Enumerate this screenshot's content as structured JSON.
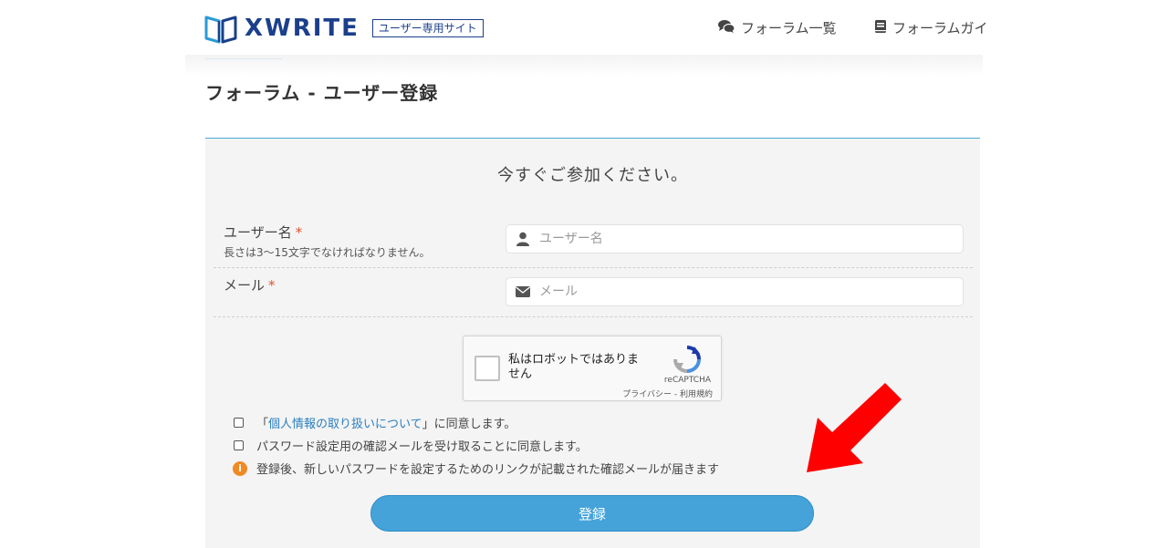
{
  "header": {
    "logo_text": "XWRITE",
    "logo_badge": "ユーザー専用サイト",
    "nav": [
      {
        "label": "フォーラム一覧",
        "icon": "comments-icon"
      },
      {
        "label": "フォーラムガイ",
        "icon": "book-icon"
      }
    ]
  },
  "page": {
    "title": "フォーラム - ユーザー登録"
  },
  "form": {
    "heading": "今すぐご参加ください。",
    "username": {
      "label": "ユーザー名",
      "required_mark": "*",
      "hint": "長さは3〜15文字でなければなりません。",
      "placeholder": "ユーザー名",
      "value": ""
    },
    "email": {
      "label": "メール",
      "required_mark": "*",
      "placeholder": "メール",
      "value": ""
    },
    "recaptcha": {
      "text": "私はロボットではありません",
      "brand": "reCAPTCHA",
      "terms": "プライバシー - 利用規約"
    },
    "privacy_consent": {
      "prefix": "「",
      "link": "個人情報の取り扱いについて",
      "suffix": "」に同意します。",
      "checked": false
    },
    "email_consent": {
      "label": "パスワード設定用の確認メールを受け取ることに同意します。",
      "checked": false
    },
    "info_note": "登録後、新しいパスワードを設定するためのリンクが記載された確認メールが届きます",
    "submit_label": "登録"
  },
  "colors": {
    "brand": "#1b3f8b",
    "accent": "#45a3d9",
    "required": "#e0522a",
    "info": "#f08a24",
    "annotation_arrow": "#ff0000"
  }
}
